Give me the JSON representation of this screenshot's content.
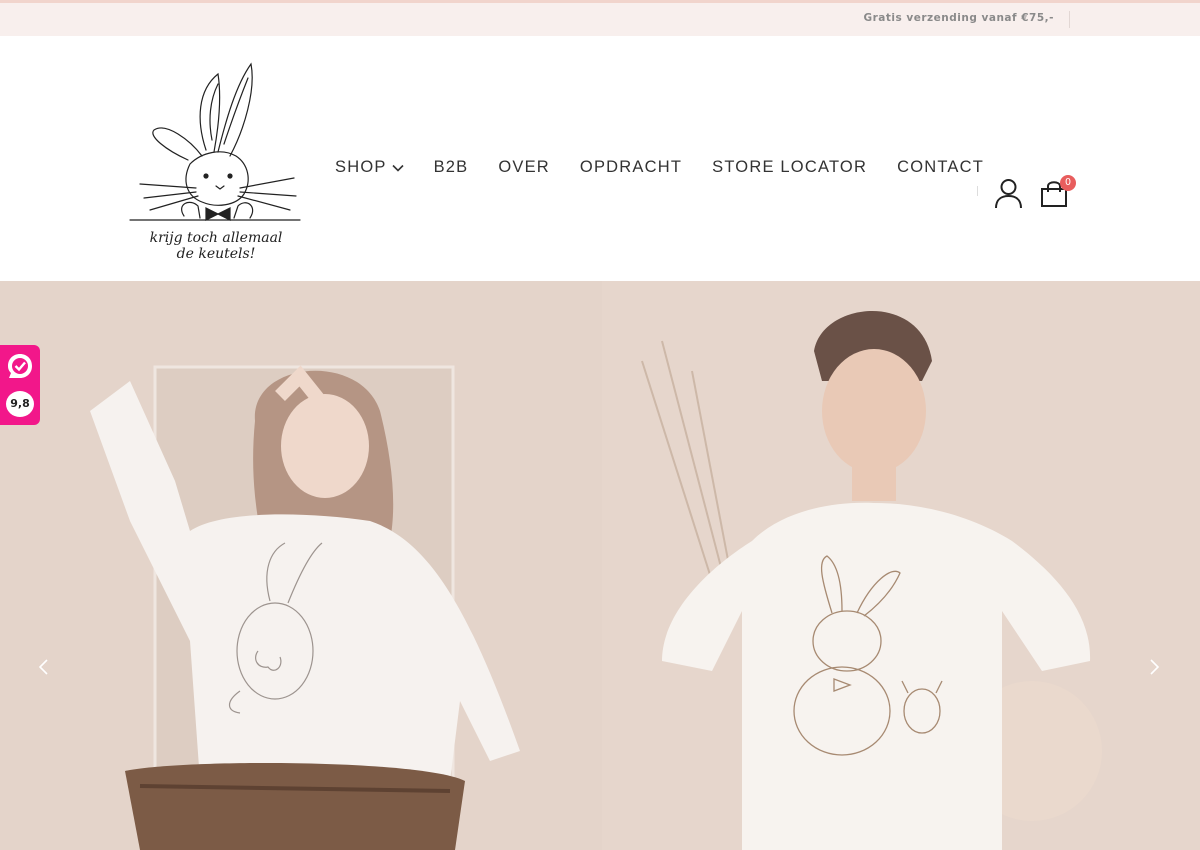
{
  "topbar": {
    "shipping_message": "Gratis verzending vanaf €75,-"
  },
  "logo": {
    "tagline_line1": "krijg toch allemaal",
    "tagline_line2": "de keutels!"
  },
  "nav": {
    "items": [
      {
        "label": "SHOP",
        "has_dropdown": true
      },
      {
        "label": "B2B"
      },
      {
        "label": "OVER"
      },
      {
        "label": "OPDRACHT"
      },
      {
        "label": "STORE LOCATOR"
      },
      {
        "label": "CONTACT"
      }
    ]
  },
  "header_icons": {
    "account_icon": "user-icon",
    "cart_icon": "shopping-bag-icon",
    "cart_count": "0"
  },
  "hero": {
    "prev_icon": "chevron-left-icon",
    "next_icon": "chevron-right-icon"
  },
  "review_badge": {
    "icon": "checkmark-badge-icon",
    "score": "9,8"
  },
  "colors": {
    "topbar_bg": "#f8efed",
    "accent_line": "#f1d4cc",
    "nav_text": "#333333",
    "cart_badge": "#e85d5d",
    "review_badge": "#f2178a",
    "hero_bg": "#e8dbd3"
  }
}
